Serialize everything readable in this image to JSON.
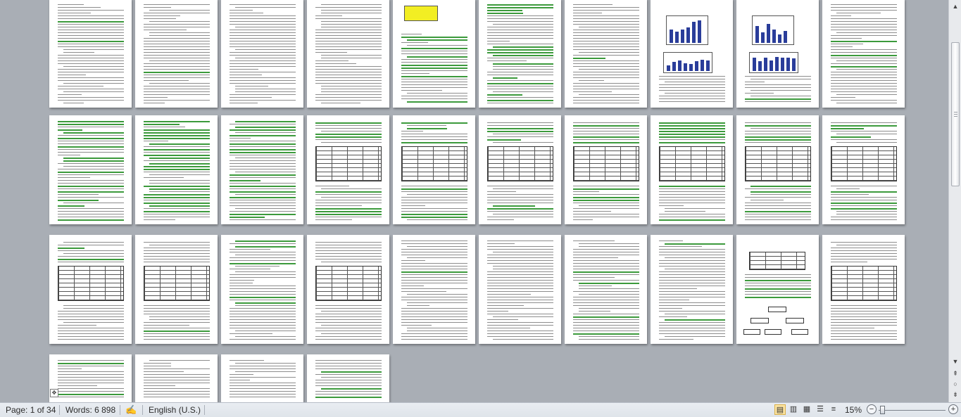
{
  "status_bar": {
    "page_info": "Page: 1 of 34",
    "words": "Words: 6 898",
    "language": "English (U.S.)",
    "zoom_level": "15%"
  },
  "view_buttons": [
    {
      "name": "print-layout",
      "icon": "print-layout-icon",
      "active": true
    },
    {
      "name": "full-screen-reading",
      "icon": "book-icon",
      "active": false
    },
    {
      "name": "web-layout",
      "icon": "web-layout-icon",
      "active": false
    },
    {
      "name": "outline",
      "icon": "outline-icon",
      "active": false
    },
    {
      "name": "draft",
      "icon": "draft-icon",
      "active": false
    }
  ],
  "icons": {
    "spell_check": "spell-check-icon",
    "zoom_out": "minus-icon",
    "zoom_in": "plus-icon",
    "scroll_up": "arrow-up-icon",
    "scroll_down": "arrow-down-icon",
    "prev_page": "prev-page-icon",
    "select_browse": "select-browse-object-icon",
    "next_page": "next-page-icon",
    "move_handle": "move-handle-icon"
  },
  "document": {
    "total_pages": 34,
    "current_page": 1
  },
  "colors": {
    "workspace": "#a9aeb5",
    "highlight_green": "#3c9a3c",
    "chart_yellow": "#f2ee23",
    "chart_blue": "#2a3d9a"
  }
}
